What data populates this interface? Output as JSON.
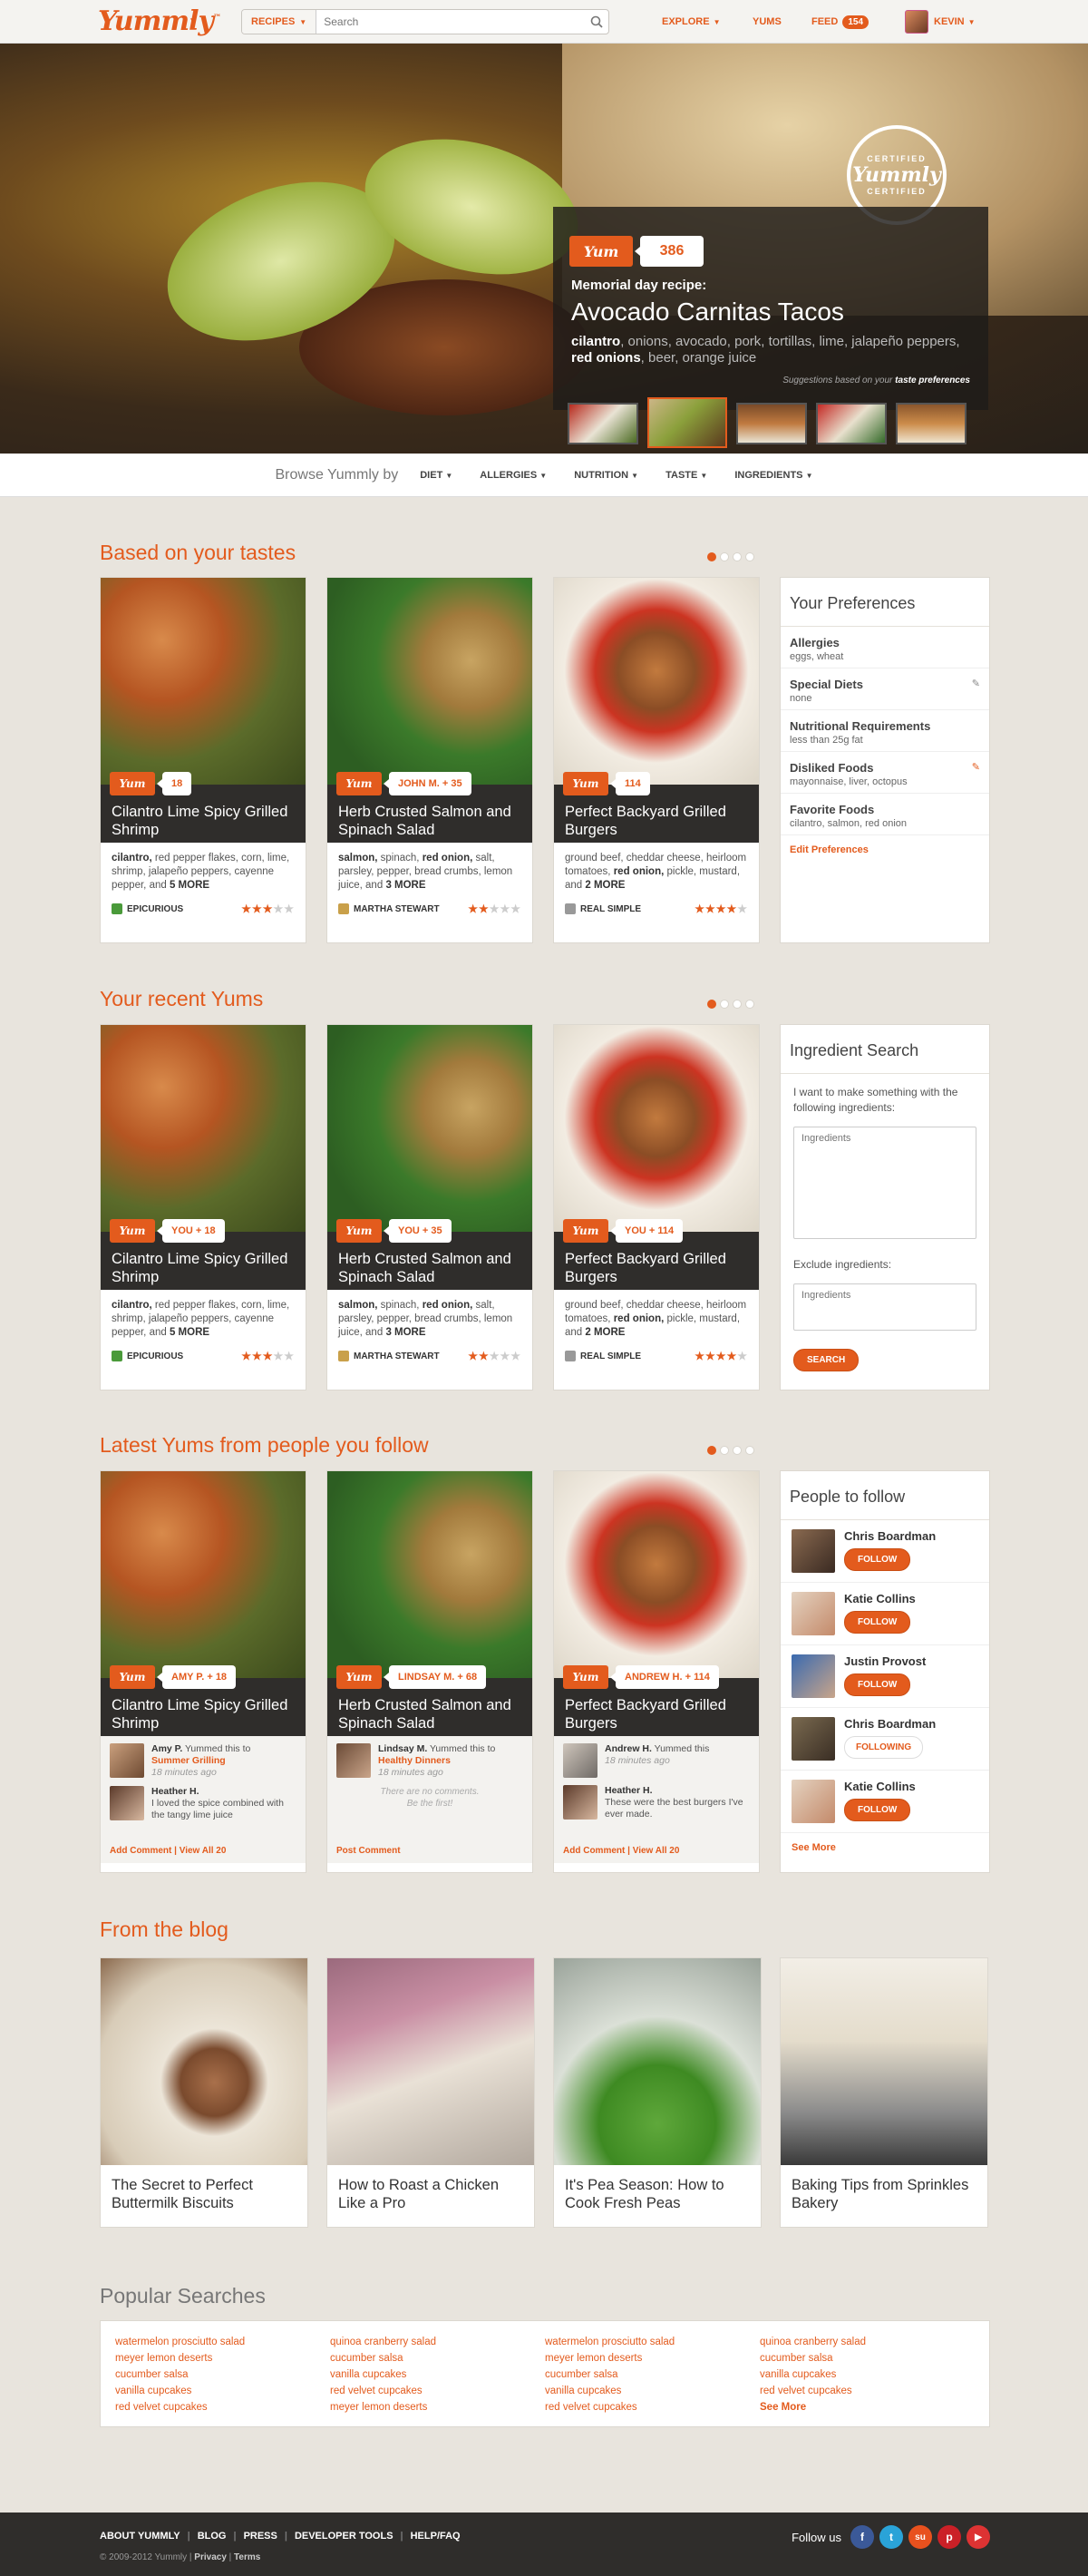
{
  "header": {
    "logo": "Yummly",
    "logo_tm": "™",
    "recipes_label": "RECIPES",
    "search_placeholder": "Search",
    "nav": {
      "explore": "EXPLORE",
      "yums": "YUMS",
      "feed": "FEED",
      "feed_count": "154",
      "user": "KEVIN"
    }
  },
  "hero": {
    "certified_top": "CERTIFIED",
    "certified_logo": "Yummly",
    "certified_bottom": "CERTIFIED",
    "yum_label": "Yum",
    "yum_count": "386",
    "kicker": "Memorial day recipe:",
    "title": "Avocado Carnitas Tacos",
    "ingredients_bold1": "cilantro",
    "ingredients_rest1": ", onions, avocado, pork, tortillas, lime, jalapeño peppers, ",
    "ingredients_bold2": "red onions",
    "ingredients_rest2": ", beer, orange juice",
    "suggest_prefix": "Suggestions based on your ",
    "suggest_link": "taste preferences",
    "thumbs_selected": 2
  },
  "browse": {
    "label": "Browse Yummly by",
    "items": [
      "DIET",
      "ALLERGIES",
      "NUTRITION",
      "TASTE",
      "INGREDIENTS"
    ]
  },
  "sections": {
    "tastes": "Based on your tastes",
    "recent": "Your recent Yums",
    "latest": "Latest Yums from people you follow",
    "blog": "From the blog",
    "popular": "Popular Searches"
  },
  "recipes": [
    {
      "title": "Cilantro Lime Spicy Grilled Shrimp",
      "ingr_bold": "cilantro,",
      "ingr": " red pepper flakes, corn, lime, shrimp, jalapeño peppers, cayenne pepper, and ",
      "more": "5 MORE",
      "source": "EPICURIOUS",
      "stars": 3
    },
    {
      "title": "Herb Crusted Salmon and Spinach Salad",
      "ingr_bold": "salmon,",
      "ingr": " spinach, ",
      "ingr_bold2": "red onion,",
      "ingr2": " salt, parsley, pepper, bread crumbs, lemon juice, and ",
      "more": "3 MORE",
      "source": "MARTHA STEWART",
      "stars": 2
    },
    {
      "title": "Perfect Backyard Grilled Burgers",
      "ingr": "ground beef, cheddar cheese, heirloom tomatoes, ",
      "ingr_bold2": "red onion,",
      "ingr2": " pickle, mustard, and ",
      "more": "2 MORE",
      "source": "REAL SIMPLE",
      "stars": 4
    }
  ],
  "tastes_counts": [
    "18",
    "JOHN M. + 35",
    "114"
  ],
  "recent_counts": [
    "YOU + 18",
    "YOU + 35",
    "YOU + 114"
  ],
  "latest_counts": [
    "AMY P. + 18",
    "LINDSAY M. + 68",
    "ANDREW H. + 114"
  ],
  "yum_label": "Yum",
  "preferences": {
    "title": "Your Preferences",
    "items": [
      {
        "label": "Allergies",
        "value": "eggs, wheat"
      },
      {
        "label": "Special Diets",
        "value": "none"
      },
      {
        "label": "Nutritional Requirements",
        "value": "less than 25g fat"
      },
      {
        "label": "Disliked Foods",
        "value": "mayonnaise, liver, octopus"
      },
      {
        "label": "Favorite Foods",
        "value": "cilantro, salmon, red onion"
      }
    ],
    "edit": "Edit Preferences"
  },
  "ingredient_search": {
    "title": "Ingredient Search",
    "label": "I want to make something with the following ingredients:",
    "placeholder": "Ingredients",
    "exclude_label": "Exclude ingredients:",
    "exclude_placeholder": "Ingredients",
    "button": "SEARCH"
  },
  "people": {
    "title": "People to follow",
    "items": [
      {
        "name": "Chris Boardman",
        "button": "FOLLOW"
      },
      {
        "name": "Katie Collins",
        "button": "FOLLOW"
      },
      {
        "name": "Justin Provost",
        "button": "FOLLOW"
      },
      {
        "name": "Chris Boardman",
        "button": "FOLLOWING"
      },
      {
        "name": "Katie Collins",
        "button": "FOLLOW"
      }
    ],
    "see_more": "See More"
  },
  "social": [
    {
      "yum_name": "Amy P.",
      "yum_text": " Yummed this to ",
      "yum_link": "Summer Grilling",
      "yum_time": "18 minutes ago",
      "comment_name": "Heather H.",
      "comment": "I loved the spice combined with the tangy lime juice",
      "links": [
        "Add Comment",
        "View All 20"
      ]
    },
    {
      "yum_name": "Lindsay M.",
      "yum_text": " Yummed this to ",
      "yum_link": "Healthy Dinners",
      "yum_time": "18 minutes ago",
      "empty1": "There are no comments.",
      "empty2": "Be the first!",
      "links": [
        "Post Comment"
      ]
    },
    {
      "yum_name": "Andrew H.",
      "yum_text": " Yummed this",
      "yum_time": "18 minutes ago",
      "comment_name": "Heather H.",
      "comment": "These were the best burgers I've ever made.",
      "links": [
        "Add Comment",
        "View All 20"
      ]
    }
  ],
  "blog": [
    "The Secret to Perfect Buttermilk Biscuits",
    "How to Roast a Chicken Like a Pro",
    "It's Pea Season: How to Cook Fresh Peas",
    "Baking Tips from Sprinkles Bakery"
  ],
  "popular": {
    "columns": [
      [
        "watermelon prosciutto salad",
        "meyer lemon deserts",
        "cucumber salsa",
        "vanilla cupcakes",
        "red velvet cupcakes"
      ],
      [
        "quinoa cranberry salad",
        "cucumber salsa",
        "vanilla cupcakes",
        "red velvet cupcakes",
        "meyer lemon deserts"
      ],
      [
        "watermelon prosciutto salad",
        "meyer lemon deserts",
        "cucumber salsa",
        "vanilla cupcakes",
        "red velvet cupcakes"
      ],
      [
        "quinoa cranberry salad",
        "cucumber salsa",
        "vanilla cupcakes",
        "red velvet cupcakes"
      ]
    ],
    "see_more": "See More"
  },
  "footer": {
    "links": [
      "ABOUT YUMMLY",
      "BLOG",
      "PRESS",
      "DEVELOPER TOOLS",
      "HELP/FAQ"
    ],
    "copyright": "© 2009-2012 Yummly",
    "privacy": "Privacy",
    "terms": "Terms",
    "follow": "Follow us",
    "social": [
      {
        "icon": "facebook-icon",
        "glyph": "f",
        "color": "#3b5998"
      },
      {
        "icon": "twitter-icon",
        "glyph": "t",
        "color": "#2aa3d8"
      },
      {
        "icon": "stumbleupon-icon",
        "glyph": "su",
        "color": "#e8511e"
      },
      {
        "icon": "pinterest-icon",
        "glyph": "p",
        "color": "#cb2027"
      },
      {
        "icon": "youtube-icon",
        "glyph": "▶",
        "color": "#d33"
      }
    ]
  },
  "colors": {
    "accent": "#e35b1d",
    "dark": "#2f2d2b",
    "background": "#e8e4dd"
  }
}
